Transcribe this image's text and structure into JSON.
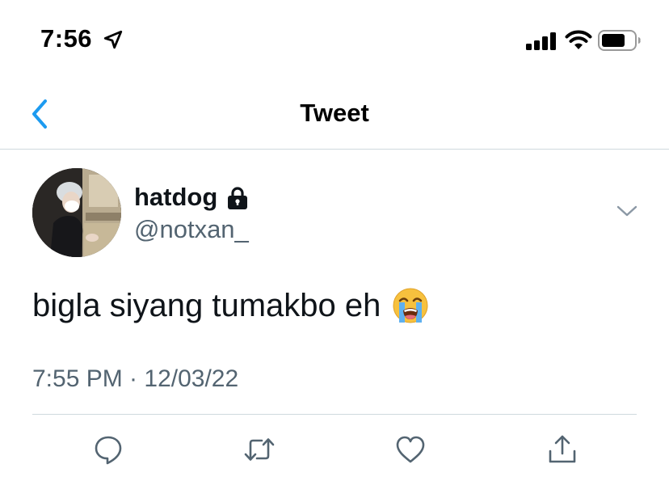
{
  "status_bar": {
    "time": "7:56",
    "icons": [
      "location-arrow-icon",
      "cellular-signal-icon",
      "wifi-icon",
      "battery-icon"
    ]
  },
  "nav": {
    "title": "Tweet",
    "back_icon": "chevron-left-icon"
  },
  "tweet": {
    "display_name": "hatdog",
    "protected_icon": "lock-icon",
    "handle": "@notxan_",
    "text": "bigla siyang tumakbo eh",
    "emoji": "loudly-crying-face",
    "timestamp": "7:55 PM · 12/03/22",
    "more_icon": "chevron-down-icon"
  },
  "actions": [
    {
      "name": "reply",
      "icon": "reply-icon"
    },
    {
      "name": "retweet",
      "icon": "retweet-icon"
    },
    {
      "name": "like",
      "icon": "heart-icon"
    },
    {
      "name": "share",
      "icon": "share-icon"
    }
  ],
  "colors": {
    "accent": "#1d9bf0",
    "secondary_text": "#536471",
    "primary_text": "#0f1419",
    "divider": "#cfd9de",
    "action_icon": "#536471"
  }
}
